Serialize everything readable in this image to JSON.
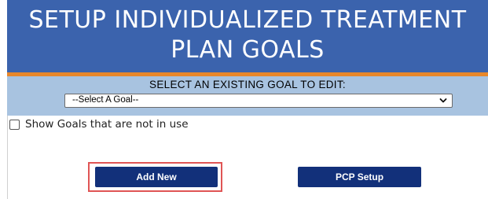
{
  "header": {
    "title": "SETUP INDIVIDUALIZED TREATMENT PLAN GOALS"
  },
  "goal_select": {
    "label": "SELECT AN EXISTING GOAL TO EDIT:",
    "selected": "--Select A Goal--"
  },
  "show_unused": {
    "label": "Show Goals that are not in use",
    "checked": false
  },
  "buttons": {
    "add_new": "Add New",
    "pcp_setup": "PCP Setup"
  },
  "colors": {
    "header_bg": "#3b63ad",
    "accent_bar": "#e8872a",
    "select_band": "#a8c3e0",
    "button_bg": "#12307a",
    "highlight": "#e05555"
  },
  "icons": {
    "select_arrow": "chevron-down-icon"
  }
}
